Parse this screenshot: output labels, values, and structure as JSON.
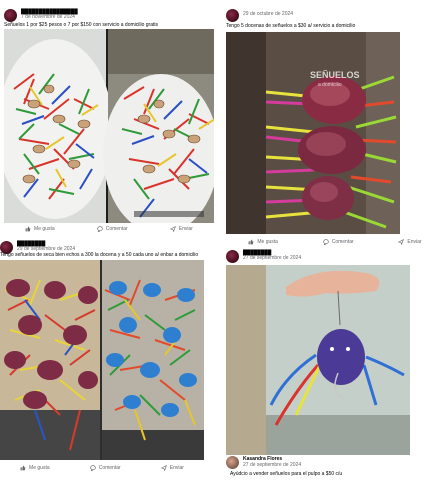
{
  "posts": [
    {
      "author": "████████████████",
      "date": "7 de noviembre de 2024",
      "text": "Señuelos 1 por $25 pesos o 7 por $150 con servicio a domicilio gratis",
      "actions": {
        "like": "Me gusta",
        "comment": "Comentar",
        "share": "Enviar"
      }
    },
    {
      "author": "",
      "date": "29 de octubre de 2024",
      "text": "Tengo 5 docenas de señuelos a $30 a/ servicio a domicilio",
      "watermark_title": "SEÑUELOS",
      "watermark_sub": "a domicilio",
      "actions": {
        "like": "Me gusta",
        "comment": "Comentar",
        "share": "Enviar"
      }
    },
    {
      "author": "████████",
      "date": "29 de septiembre de 2024",
      "text": "Tengo señuelos de seca bien echos a 300 la docena y a 50 cada uno a/ enbar a domicilio",
      "actions": {
        "like": "Me gusta",
        "comment": "Comentar",
        "share": "Enviar"
      }
    },
    {
      "author": "████████",
      "date": "27 de septiembre de 2024",
      "commenter_name": "Kasandra Flores",
      "commenter_date": "27 de septiembre de 2024",
      "text": "Ayúdcio a vender señuelos para el pulpo a $50 c/u"
    }
  ]
}
